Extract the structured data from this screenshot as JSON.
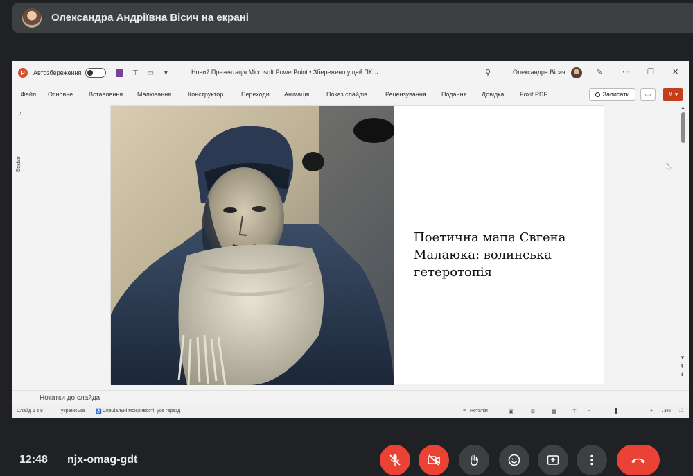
{
  "meet": {
    "presenter_banner": "Олександра Андріївна Вісич на екрані",
    "time": "12:48",
    "meeting_code": "njx-omag-gdt",
    "colors": {
      "background": "#202124",
      "control": "#3c4043",
      "danger": "#ea4335"
    },
    "controls": [
      "mic-off-icon",
      "camera-off-icon",
      "raise-hand-icon",
      "emoji-icon",
      "present-icon",
      "more-icon",
      "end-call-icon"
    ]
  },
  "powerpoint": {
    "autosave_label": "Автозбереження",
    "document_title": "Новий Презентація Microsoft PowerPoint • Збережено у цей ПК ⌄",
    "user_name": "Олександра Вісич",
    "ribbon_tabs": [
      "Файл",
      "Основне",
      "Вставлення",
      "Малювання",
      "Конструктор",
      "Переходи",
      "Анімація",
      "Показ слайдів",
      "Рецензування",
      "Подання",
      "Довідка",
      "Foxit PDF"
    ],
    "record_label": "Записати",
    "thumbnails_label": "Ескізи",
    "slide": {
      "title": "Поетична мапа Євгена Малаюка: волинська гетеротопія"
    },
    "notes_placeholder": "Нотатки до слайда",
    "status": {
      "slide_counter": "Слайд 1 з 8",
      "language": "українська",
      "accessibility": "Спеціальні можливості: усе гаразд",
      "notes_button": "Нотатки",
      "zoom": "73%"
    },
    "accent_color": "#c43e1c"
  }
}
